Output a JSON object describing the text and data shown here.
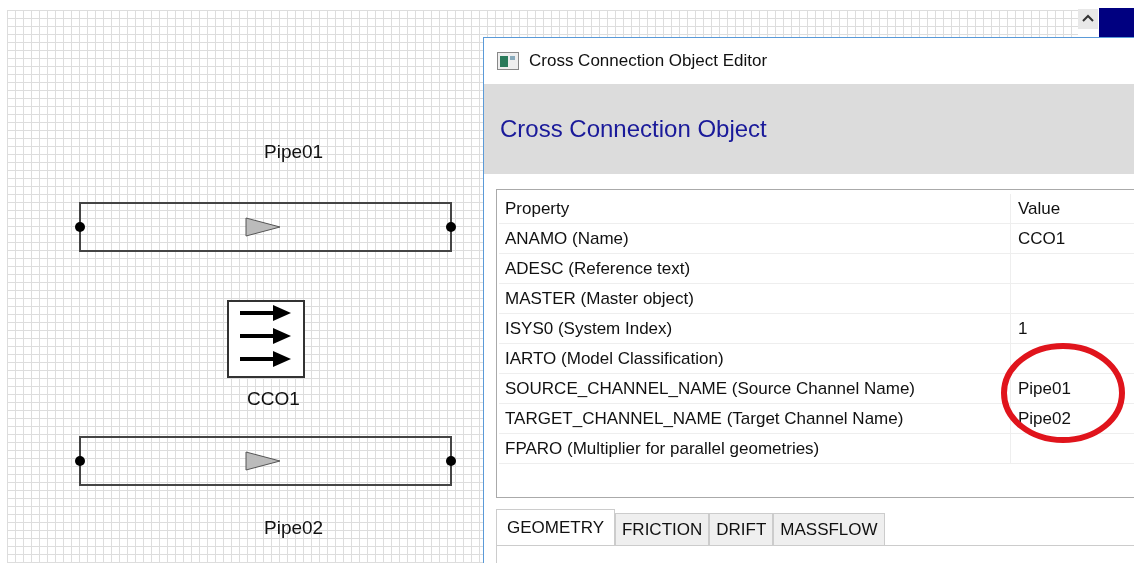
{
  "canvas": {
    "nodes": [
      {
        "kind": "pipe",
        "label": "Pipe01"
      },
      {
        "kind": "cross_connection",
        "label": "CCO1"
      },
      {
        "kind": "pipe",
        "label": "Pipe02"
      }
    ]
  },
  "dialog": {
    "title": "Cross Connection Object Editor",
    "heading": "Cross Connection Object",
    "table": {
      "columns": [
        "Property",
        "Value"
      ],
      "rows": [
        {
          "property": "ANAMO (Name)",
          "value": "CCO1"
        },
        {
          "property": "ADESC (Reference text)"
        },
        {
          "property": "MASTER (Master object)"
        },
        {
          "property": "ISYS0 (System Index)",
          "value": "1"
        },
        {
          "property": "IARTO (Model Classification)"
        },
        {
          "property": "SOURCE_CHANNEL_NAME (Source Channel Name)",
          "value": "Pipe01"
        },
        {
          "property": "TARGET_CHANNEL_NAME (Target Channel Name)",
          "value": "Pipe02"
        },
        {
          "property": "FPARO (Multiplier for parallel geometries)"
        }
      ]
    },
    "tabs": [
      {
        "label": "GEOMETRY",
        "selected": true
      },
      {
        "label": "FRICTION",
        "selected": false
      },
      {
        "label": "DRIFT",
        "selected": false
      },
      {
        "label": "MASSFLOW",
        "selected": false
      }
    ]
  }
}
